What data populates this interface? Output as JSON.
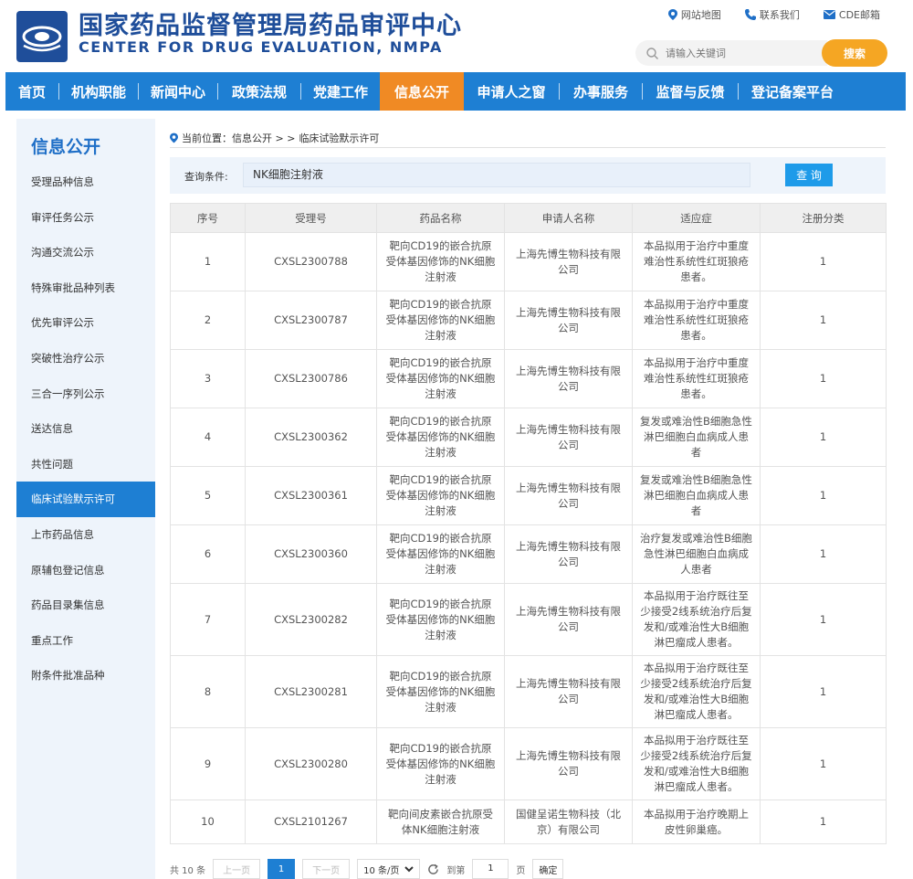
{
  "header": {
    "title_cn": "国家药品监督管理局药品审评中心",
    "title_en": "CENTER FOR DRUG EVALUATION, NMPA",
    "links": [
      {
        "label": "网站地图",
        "icon": "location-pin-icon"
      },
      {
        "label": "联系我们",
        "icon": "phone-icon"
      },
      {
        "label": "CDE邮箱",
        "icon": "mail-icon"
      }
    ],
    "search_placeholder": "请输入关键词",
    "search_button": "搜索"
  },
  "nav": {
    "items": [
      {
        "label": "首页",
        "active": false
      },
      {
        "label": "机构职能",
        "active": false
      },
      {
        "label": "新闻中心",
        "active": false
      },
      {
        "label": "政策法规",
        "active": false
      },
      {
        "label": "党建工作",
        "active": false
      },
      {
        "label": "信息公开",
        "active": true
      },
      {
        "label": "申请人之窗",
        "active": false
      },
      {
        "label": "办事服务",
        "active": false
      },
      {
        "label": "监督与反馈",
        "active": false
      },
      {
        "label": "登记备案平台",
        "active": false
      }
    ]
  },
  "sidebar": {
    "title": "信息公开",
    "items": [
      {
        "label": "受理品种信息",
        "active": false
      },
      {
        "label": "审评任务公示",
        "active": false
      },
      {
        "label": "沟通交流公示",
        "active": false
      },
      {
        "label": "特殊审批品种列表",
        "active": false
      },
      {
        "label": "优先审评公示",
        "active": false
      },
      {
        "label": "突破性治疗公示",
        "active": false
      },
      {
        "label": "三合一序列公示",
        "active": false
      },
      {
        "label": "送达信息",
        "active": false
      },
      {
        "label": "共性问题",
        "active": false
      },
      {
        "label": "临床试验默示许可",
        "active": true
      },
      {
        "label": "上市药品信息",
        "active": false
      },
      {
        "label": "原辅包登记信息",
        "active": false
      },
      {
        "label": "药品目录集信息",
        "active": false
      },
      {
        "label": "重点工作",
        "active": false
      },
      {
        "label": "附条件批准品种",
        "active": false
      }
    ]
  },
  "breadcrumb": {
    "prefix": "当前位置：信息公开 > >",
    "current": "临床试验默示许可"
  },
  "query": {
    "label": "查询条件:",
    "value": "NK细胞注射液",
    "button": "查 询"
  },
  "table": {
    "headers": [
      "序号",
      "受理号",
      "药品名称",
      "申请人名称",
      "适应症",
      "注册分类"
    ],
    "rows": [
      [
        "1",
        "CXSL2300788",
        "靶向CD19的嵌合抗原受体基因修饰的NK细胞注射液",
        "上海先博生物科技有限公司",
        "本品拟用于治疗中重度难治性系统性红斑狼疮患者。",
        "1"
      ],
      [
        "2",
        "CXSL2300787",
        "靶向CD19的嵌合抗原受体基因修饰的NK细胞注射液",
        "上海先博生物科技有限公司",
        "本品拟用于治疗中重度难治性系统性红斑狼疮患者。",
        "1"
      ],
      [
        "3",
        "CXSL2300786",
        "靶向CD19的嵌合抗原受体基因修饰的NK细胞注射液",
        "上海先博生物科技有限公司",
        "本品拟用于治疗中重度难治性系统性红斑狼疮患者。",
        "1"
      ],
      [
        "4",
        "CXSL2300362",
        "靶向CD19的嵌合抗原受体基因修饰的NK细胞注射液",
        "上海先博生物科技有限公司",
        "复发或难治性B细胞急性淋巴细胞白血病成人患者",
        "1"
      ],
      [
        "5",
        "CXSL2300361",
        "靶向CD19的嵌合抗原受体基因修饰的NK细胞注射液",
        "上海先博生物科技有限公司",
        "复发或难治性B细胞急性淋巴细胞白血病成人患者",
        "1"
      ],
      [
        "6",
        "CXSL2300360",
        "靶向CD19的嵌合抗原受体基因修饰的NK细胞注射液",
        "上海先博生物科技有限公司",
        "治疗复发或难治性B细胞急性淋巴细胞白血病成人患者",
        "1"
      ],
      [
        "7",
        "CXSL2300282",
        "靶向CD19的嵌合抗原受体基因修饰的NK细胞注射液",
        "上海先博生物科技有限公司",
        "本品拟用于治疗既往至少接受2线系统治疗后复发和/或难治性大B细胞淋巴瘤成人患者。",
        "1"
      ],
      [
        "8",
        "CXSL2300281",
        "靶向CD19的嵌合抗原受体基因修饰的NK细胞注射液",
        "上海先博生物科技有限公司",
        "本品拟用于治疗既往至少接受2线系统治疗后复发和/或难治性大B细胞淋巴瘤成人患者。",
        "1"
      ],
      [
        "9",
        "CXSL2300280",
        "靶向CD19的嵌合抗原受体基因修饰的NK细胞注射液",
        "上海先博生物科技有限公司",
        "本品拟用于治疗既往至少接受2线系统治疗后复发和/或难治性大B细胞淋巴瘤成人患者。",
        "1"
      ],
      [
        "10",
        "CXSL2101267",
        "靶向间皮素嵌合抗原受体NK细胞注射液",
        "国健呈诺生物科技（北京）有限公司",
        "本品拟用于治疗晚期上皮性卵巢癌。",
        "1"
      ]
    ]
  },
  "pager": {
    "total": "共 10 条",
    "prev": "上一页",
    "current": "1",
    "next": "下一页",
    "page_size": "10 条/页",
    "goto_label": "到第",
    "goto_value": "1",
    "page_unit": "页",
    "confirm": "确定"
  },
  "colors": {
    "brand_blue": "#1f4e9a",
    "nav_blue": "#1e7fd3",
    "active_orange": "#f08a24",
    "search_orange": "#f5a623"
  }
}
